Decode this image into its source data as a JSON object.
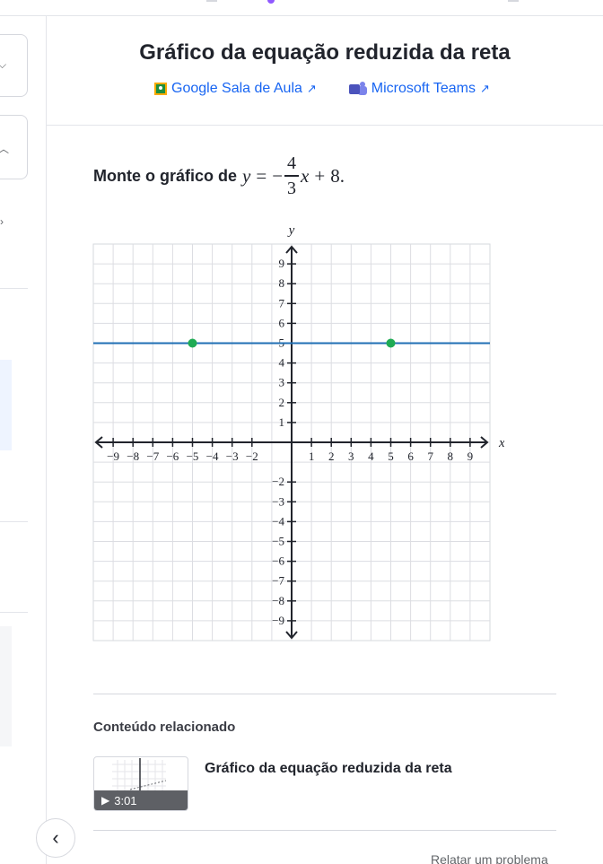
{
  "page": {
    "title": "Gráfico da equação reduzida da reta"
  },
  "share": {
    "google_classroom": "Google Sala de Aula",
    "microsoft_teams": "Microsoft Teams"
  },
  "problem": {
    "prompt": "Monte o gráfico de",
    "equation": {
      "lhs": "y",
      "equals": "=",
      "minus": "−",
      "numerator": "4",
      "denominator": "3",
      "variable": "x",
      "plus": "+",
      "constant": "8",
      "period": "."
    }
  },
  "chart_data": {
    "type": "line",
    "xlabel": "x",
    "ylabel": "y",
    "xlim": [
      -10,
      10
    ],
    "ylim": [
      -10,
      10
    ],
    "grid": true,
    "tick_labels_x": [
      -9,
      -8,
      -7,
      -6,
      -5,
      -4,
      -3,
      -2,
      1,
      2,
      3,
      4,
      5,
      6,
      7,
      8,
      9
    ],
    "tick_labels_y": [
      9,
      8,
      7,
      6,
      5,
      4,
      3,
      2,
      1,
      -2,
      -3,
      -4,
      -5,
      -6,
      -7,
      -8,
      -9
    ],
    "line": {
      "x": [
        -10,
        10
      ],
      "y": [
        5,
        5
      ],
      "color": "#1f6fb4"
    },
    "points": [
      {
        "x": -5,
        "y": 5
      },
      {
        "x": 5,
        "y": 5
      }
    ],
    "point_color": "#1fab54"
  },
  "related": {
    "heading": "Conteúdo relacionado",
    "items": [
      {
        "title": "Gráfico da equação reduzida da reta",
        "duration": "3:01",
        "play_icon": "play-icon"
      }
    ]
  },
  "footer": {
    "report": "Relatar um problema"
  },
  "icons": {
    "back": "chevron-left-icon",
    "external": "external-link-icon"
  },
  "colors": {
    "link": "#1865f2",
    "line": "#1f6fb4",
    "point": "#1fab54"
  }
}
